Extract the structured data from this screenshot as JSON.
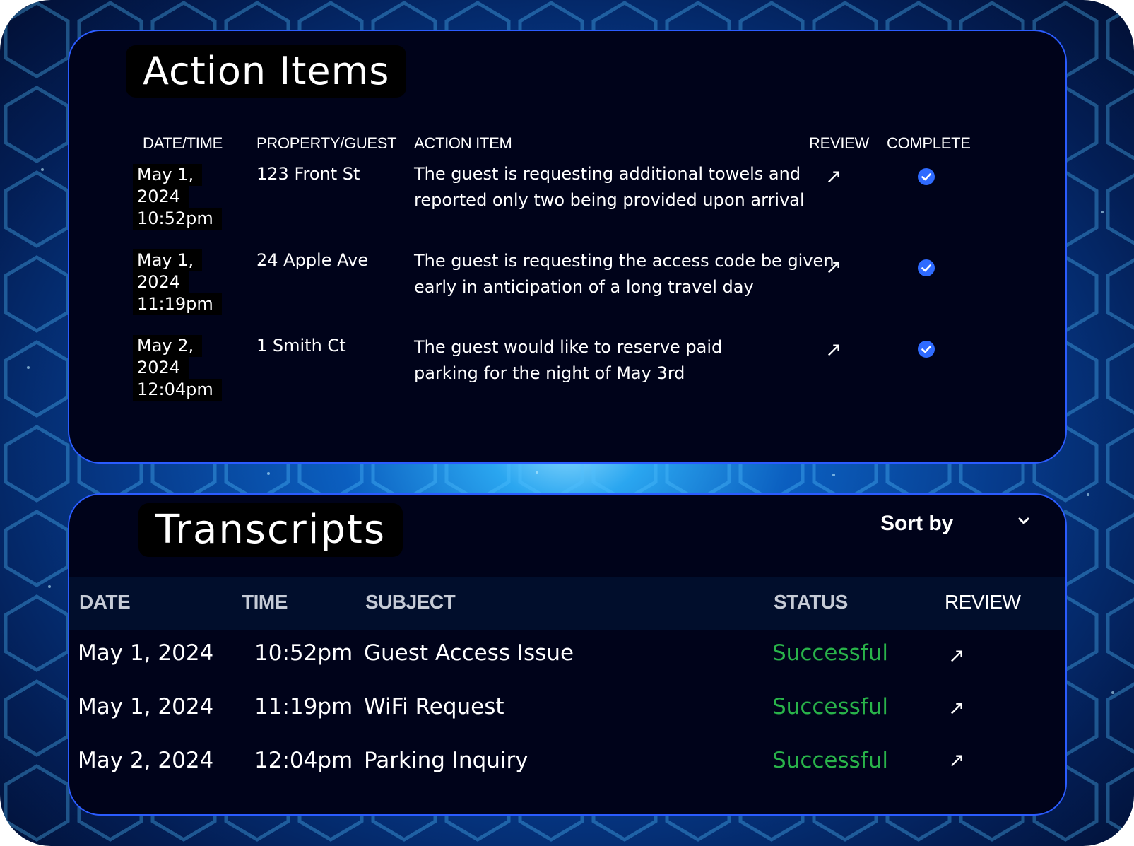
{
  "colors": {
    "accent": "#2f6bff",
    "success": "#29b34a",
    "panel": "#00031a",
    "border": "#2b5cff"
  },
  "action_items": {
    "title": "Action Items",
    "columns": {
      "datetime": "DATE/TIME",
      "property": "PROPERTY/GUEST",
      "item": "ACTION ITEM",
      "review": "REVIEW",
      "complete": "COMPLETE"
    },
    "rows": [
      {
        "date": "May 1,",
        "year": "2024",
        "time": "10:52pm",
        "property": "123 Front St",
        "line1": "The guest is requesting additional  towels and",
        "line2": "reported only two being provided upon arrival",
        "review_icon": "arrow-up-right-icon",
        "complete_icon": "check-circle-icon"
      },
      {
        "date": "May 1,",
        "year": "2024",
        "time": "11:19pm",
        "property": "24 Apple Ave",
        "line1": "The guest is requesting the access code be given",
        "line2": "early in anticipation of a long travel day",
        "review_icon": "arrow-up-right-icon",
        "complete_icon": "check-circle-icon"
      },
      {
        "date": "May 2,",
        "year": "2024",
        "time": "12:04pm",
        "property": "1 Smith Ct",
        "line1": "The guest would like to reserve paid",
        "line2": "parking for the night of May 3rd",
        "review_icon": "arrow-up-right-icon",
        "complete_icon": "check-circle-icon"
      }
    ]
  },
  "transcripts": {
    "title": "Transcripts",
    "sort_label": "Sort by",
    "columns": {
      "date": "DATE",
      "time": "TIME",
      "subject": "SUBJECT",
      "status": "STATUS",
      "review": "REVIEW"
    },
    "rows": [
      {
        "date": "May 1, 2024",
        "time": "10:52pm",
        "subject": "Guest Access Issue",
        "status": "Successful"
      },
      {
        "date": "May 1, 2024",
        "time": "11:19pm",
        "subject": "WiFi Request",
        "status": "Successful"
      },
      {
        "date": "May 2, 2024",
        "time": "12:04pm",
        "subject": "Parking Inquiry",
        "status": "Successful"
      }
    ]
  }
}
